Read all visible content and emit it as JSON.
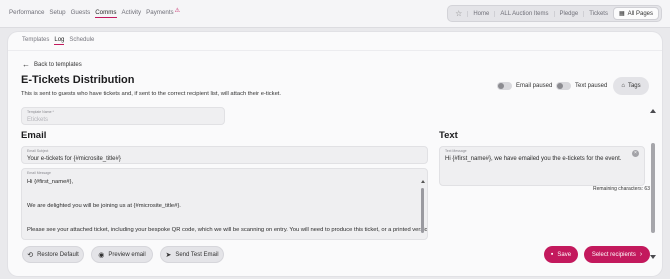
{
  "topnav": [
    {
      "label": "Performance",
      "active": false
    },
    {
      "label": "Setup",
      "active": false
    },
    {
      "label": "Guests",
      "active": false
    },
    {
      "label": "Comms",
      "active": true
    },
    {
      "label": "Activity",
      "active": false
    },
    {
      "label": "Payments",
      "active": false
    }
  ],
  "toolbar": {
    "home": "Home",
    "all_items": "ALL Auction Items",
    "pledge": "Pledge",
    "tickets": "Tickets",
    "all_pages": "All Pages"
  },
  "subtabs": [
    {
      "label": "Templates",
      "active": false
    },
    {
      "label": "Log",
      "active": true
    },
    {
      "label": "Schedule",
      "active": false
    }
  ],
  "back_label": "Back to templates",
  "title": "E-Tickets Distribution",
  "description": "This is sent to guests who have tickets and, if sent to the correct recipient list, will attach their e-ticket.",
  "toggles": {
    "email_paused": "Email paused",
    "text_paused": "Text paused"
  },
  "tags_label": "Tags",
  "template_name": {
    "label": "Template Name *",
    "placeholder": "Etickets"
  },
  "email": {
    "heading": "Email",
    "subject_label": "Email Subject",
    "subject_value": "Your e-tickets for {#microsite_title#}",
    "message_label": "Email Message",
    "message_lines": [
      "Hi {#first_name#},",
      "",
      "",
      "We are delighted you will be joining us at {#microsite_title#}.",
      "",
      "",
      "Please see your attached ticket, including your bespoke QR code, which we will be scanning on entry. You will need to produce this ticket, or a printed version, to"
    ]
  },
  "text": {
    "heading": "Text",
    "message_label": "Text Message",
    "message_value": "Hi {#first_name#}, we have emailed you the e-tickets for the event.",
    "remaining": "Remaining characters: 63"
  },
  "buttons": {
    "restore": "Restore Default",
    "preview": "Preview email",
    "send_test": "Send Test Email",
    "save": "Save",
    "select_recipients": "Select recipients"
  },
  "colors": {
    "accent": "#c3195d"
  }
}
